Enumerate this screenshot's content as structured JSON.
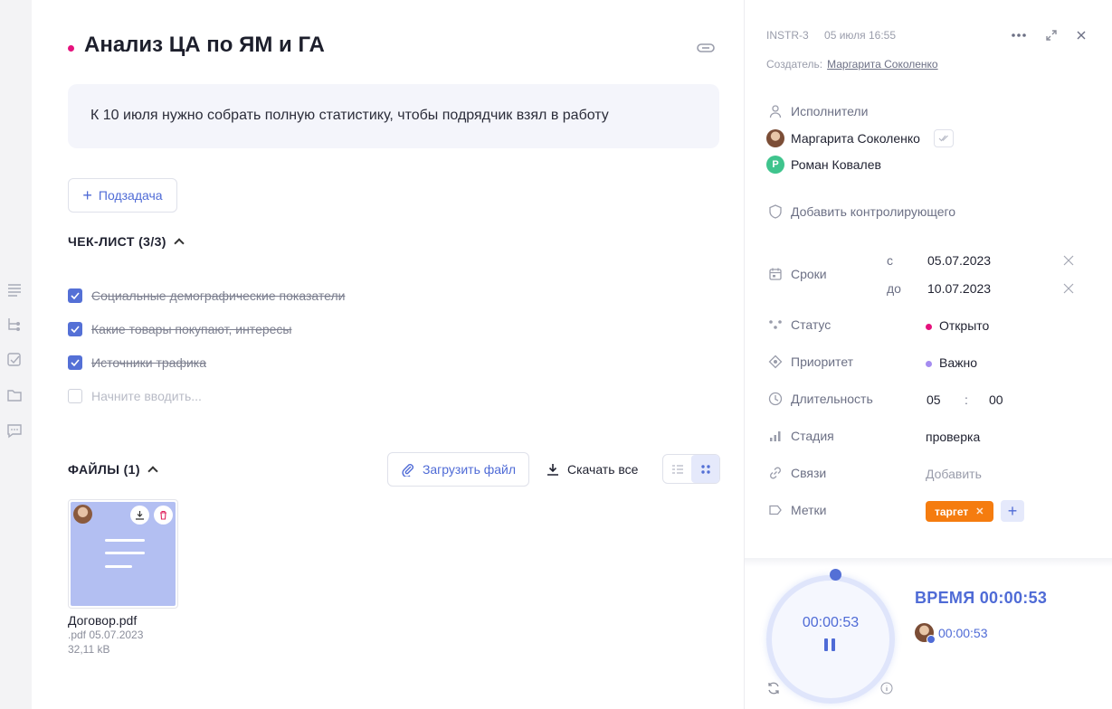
{
  "task": {
    "title": "Анализ ЦА по ЯМ и ГА",
    "description": "К 10 июля нужно собрать полную статистику, чтобы подрядчик взял в работу",
    "subtask_label": "Подзадача"
  },
  "checklist": {
    "header": "ЧЕК-ЛИСТ (3/3)",
    "items": [
      {
        "label": "Социальные демографические показатели",
        "done": true
      },
      {
        "label": "Какие товары покупают, интересы",
        "done": true
      },
      {
        "label": "Источники трафика",
        "done": true
      }
    ],
    "placeholder": "Начните вводить..."
  },
  "files": {
    "header": "ФАЙЛЫ (1)",
    "upload_label": "Загрузить файл",
    "download_all_label": "Скачать все",
    "items": [
      {
        "name": "Договор.pdf",
        "meta": ".pdf 05.07.2023",
        "size": "32,11 kB"
      }
    ]
  },
  "side": {
    "id": "INSTR-3",
    "datetime": "05 июля 16:55",
    "creator_label": "Создатель:",
    "creator_name": "Маргарита Соколенко",
    "assignees_label": "Исполнители",
    "assignees": [
      {
        "name": "Маргарита Соколенко",
        "initial": ""
      },
      {
        "name": "Роман Ковалев",
        "initial": "Р"
      }
    ],
    "add_controller": "Добавить контролирующего",
    "deadline_label": "Сроки",
    "from_label": "с",
    "from_value": "05.07.2023",
    "to_label": "до",
    "to_value": "10.07.2023",
    "status_label": "Статус",
    "status_value": "Открыто",
    "status_color": "#e5127d",
    "priority_label": "Приоритет",
    "priority_value": "Важно",
    "priority_color": "#a58cf0",
    "duration_label": "Длительность",
    "duration_hours": "05",
    "duration_sep": ":",
    "duration_minutes": "00",
    "stage_label": "Стадия",
    "stage_value": "проверка",
    "links_label": "Связи",
    "links_value": "Добавить",
    "tags_label": "Метки",
    "tag": "таргет",
    "tag_color": "#f57c0f"
  },
  "timer": {
    "display": "00:00:53",
    "title": "ВРЕМЯ 00:00:53",
    "user_time": "00:00:53"
  }
}
